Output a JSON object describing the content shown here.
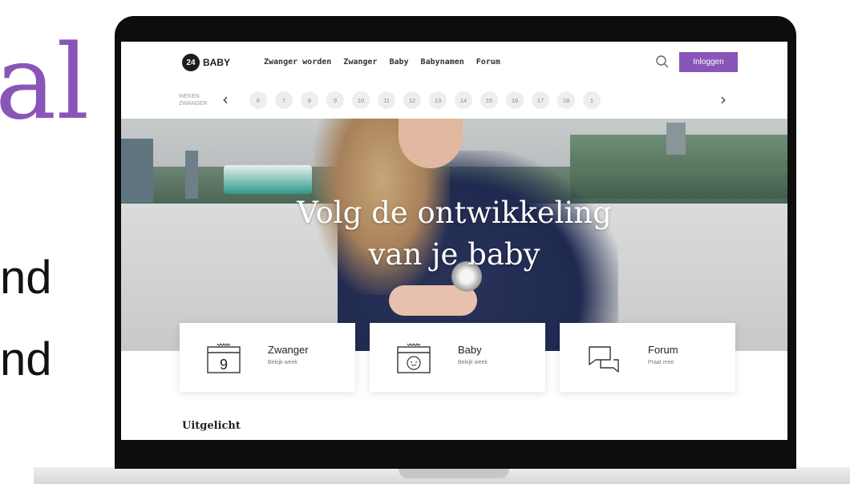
{
  "slide": {
    "partial_top": "al",
    "partial_line_1": "nd",
    "partial_line_2": "nd"
  },
  "header": {
    "logo_number": "24",
    "logo_text": "BABY",
    "nav": [
      "Zwanger worden",
      "Zwanger",
      "Baby",
      "Babynamen",
      "Forum"
    ],
    "search_icon": "search-icon",
    "login_label": "Inloggen",
    "accent_color": "#8a55b8"
  },
  "weeks": {
    "label_line_1": "Weken",
    "label_line_2": "Zwanger",
    "items": [
      "6",
      "7",
      "8",
      "9",
      "10",
      "11",
      "12",
      "13",
      "14",
      "15",
      "16",
      "17",
      "18",
      "1"
    ]
  },
  "hero": {
    "title_line_1": "Volg de ontwikkeling",
    "title_line_2": "van je baby"
  },
  "cards": [
    {
      "title": "Zwanger",
      "subtitle": "Bekijk week",
      "icon": "calendar-icon",
      "icon_number": "9"
    },
    {
      "title": "Baby",
      "subtitle": "Bekijk week",
      "icon": "baby-calendar-icon"
    },
    {
      "title": "Forum",
      "subtitle": "Praat mee",
      "icon": "chat-bubbles-icon"
    }
  ],
  "featured": {
    "heading": "Uitgelicht"
  }
}
